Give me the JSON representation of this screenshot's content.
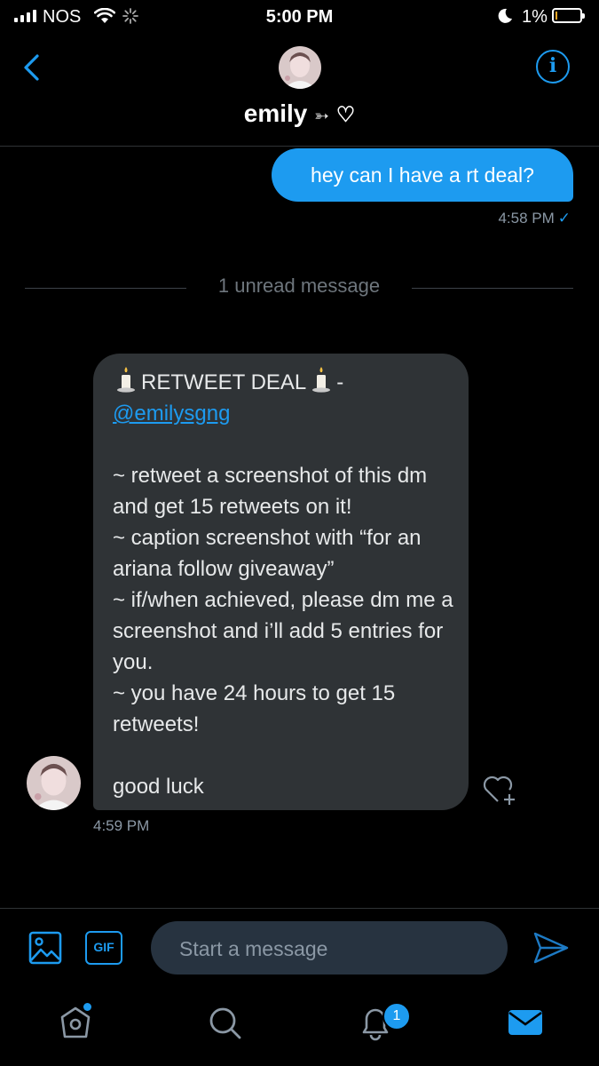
{
  "status_bar": {
    "carrier": "NOS",
    "time": "5:00 PM",
    "battery": "1%"
  },
  "header": {
    "name": "emily",
    "name_decoration_arrow": "➳",
    "name_decoration_heart": "♡",
    "info_glyph": "i"
  },
  "messages": {
    "sent": {
      "text": "hey can I have a rt deal?",
      "time": "4:58 PM",
      "read_mark": "✓"
    },
    "separator": "1 unread message",
    "received": {
      "heading": "RETWEET DEAL",
      "heading_dash": "-",
      "mention": "@emilysgng",
      "lines": [
        "~ retweet a screenshot of this dm and get 15 retweets on it!",
        "~ caption screenshot with “for an ariana follow giveaway”",
        "~ if/when achieved, please dm me a screenshot and i’ll add 5 entries for you.",
        "~ you have 24 hours to get 15 retweets!"
      ],
      "signoff": "good luck",
      "time": "4:59 PM"
    }
  },
  "composer": {
    "placeholder": "Start a message",
    "gif_label": "GIF"
  },
  "tab_bar": {
    "notifications_badge": "1"
  },
  "colors": {
    "accent": "#1d9bf0",
    "background": "#000000",
    "bubble_received": "#2f3336",
    "composer_bg": "#273340"
  }
}
